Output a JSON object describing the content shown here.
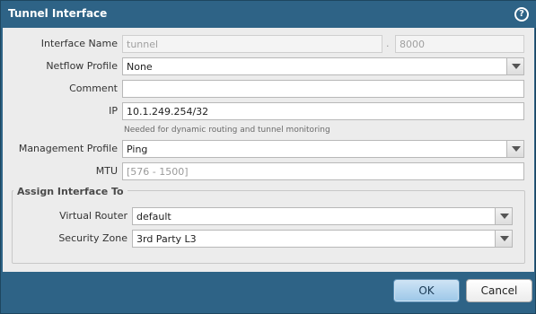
{
  "dialog": {
    "title": "Tunnel Interface",
    "help_icon": "?"
  },
  "form": {
    "interface_name": {
      "label": "Interface Name",
      "name_value": "tunnel",
      "separator": ".",
      "number_placeholder": "8000"
    },
    "netflow_profile": {
      "label": "Netflow Profile",
      "value": "None"
    },
    "comment": {
      "label": "Comment",
      "value": ""
    },
    "ip": {
      "label": "IP",
      "value": "10.1.249.254/32",
      "hint": "Needed for dynamic routing and tunnel monitoring"
    },
    "management_profile": {
      "label": "Management Profile",
      "value": "Ping"
    },
    "mtu": {
      "label": "MTU",
      "placeholder": "[576 - 1500]"
    }
  },
  "assign": {
    "legend": "Assign Interface To",
    "virtual_router": {
      "label": "Virtual Router",
      "value": "default"
    },
    "security_zone": {
      "label": "Security Zone",
      "value": "3rd Party L3"
    }
  },
  "footer": {
    "ok_label": "OK",
    "cancel_label": "Cancel"
  }
}
